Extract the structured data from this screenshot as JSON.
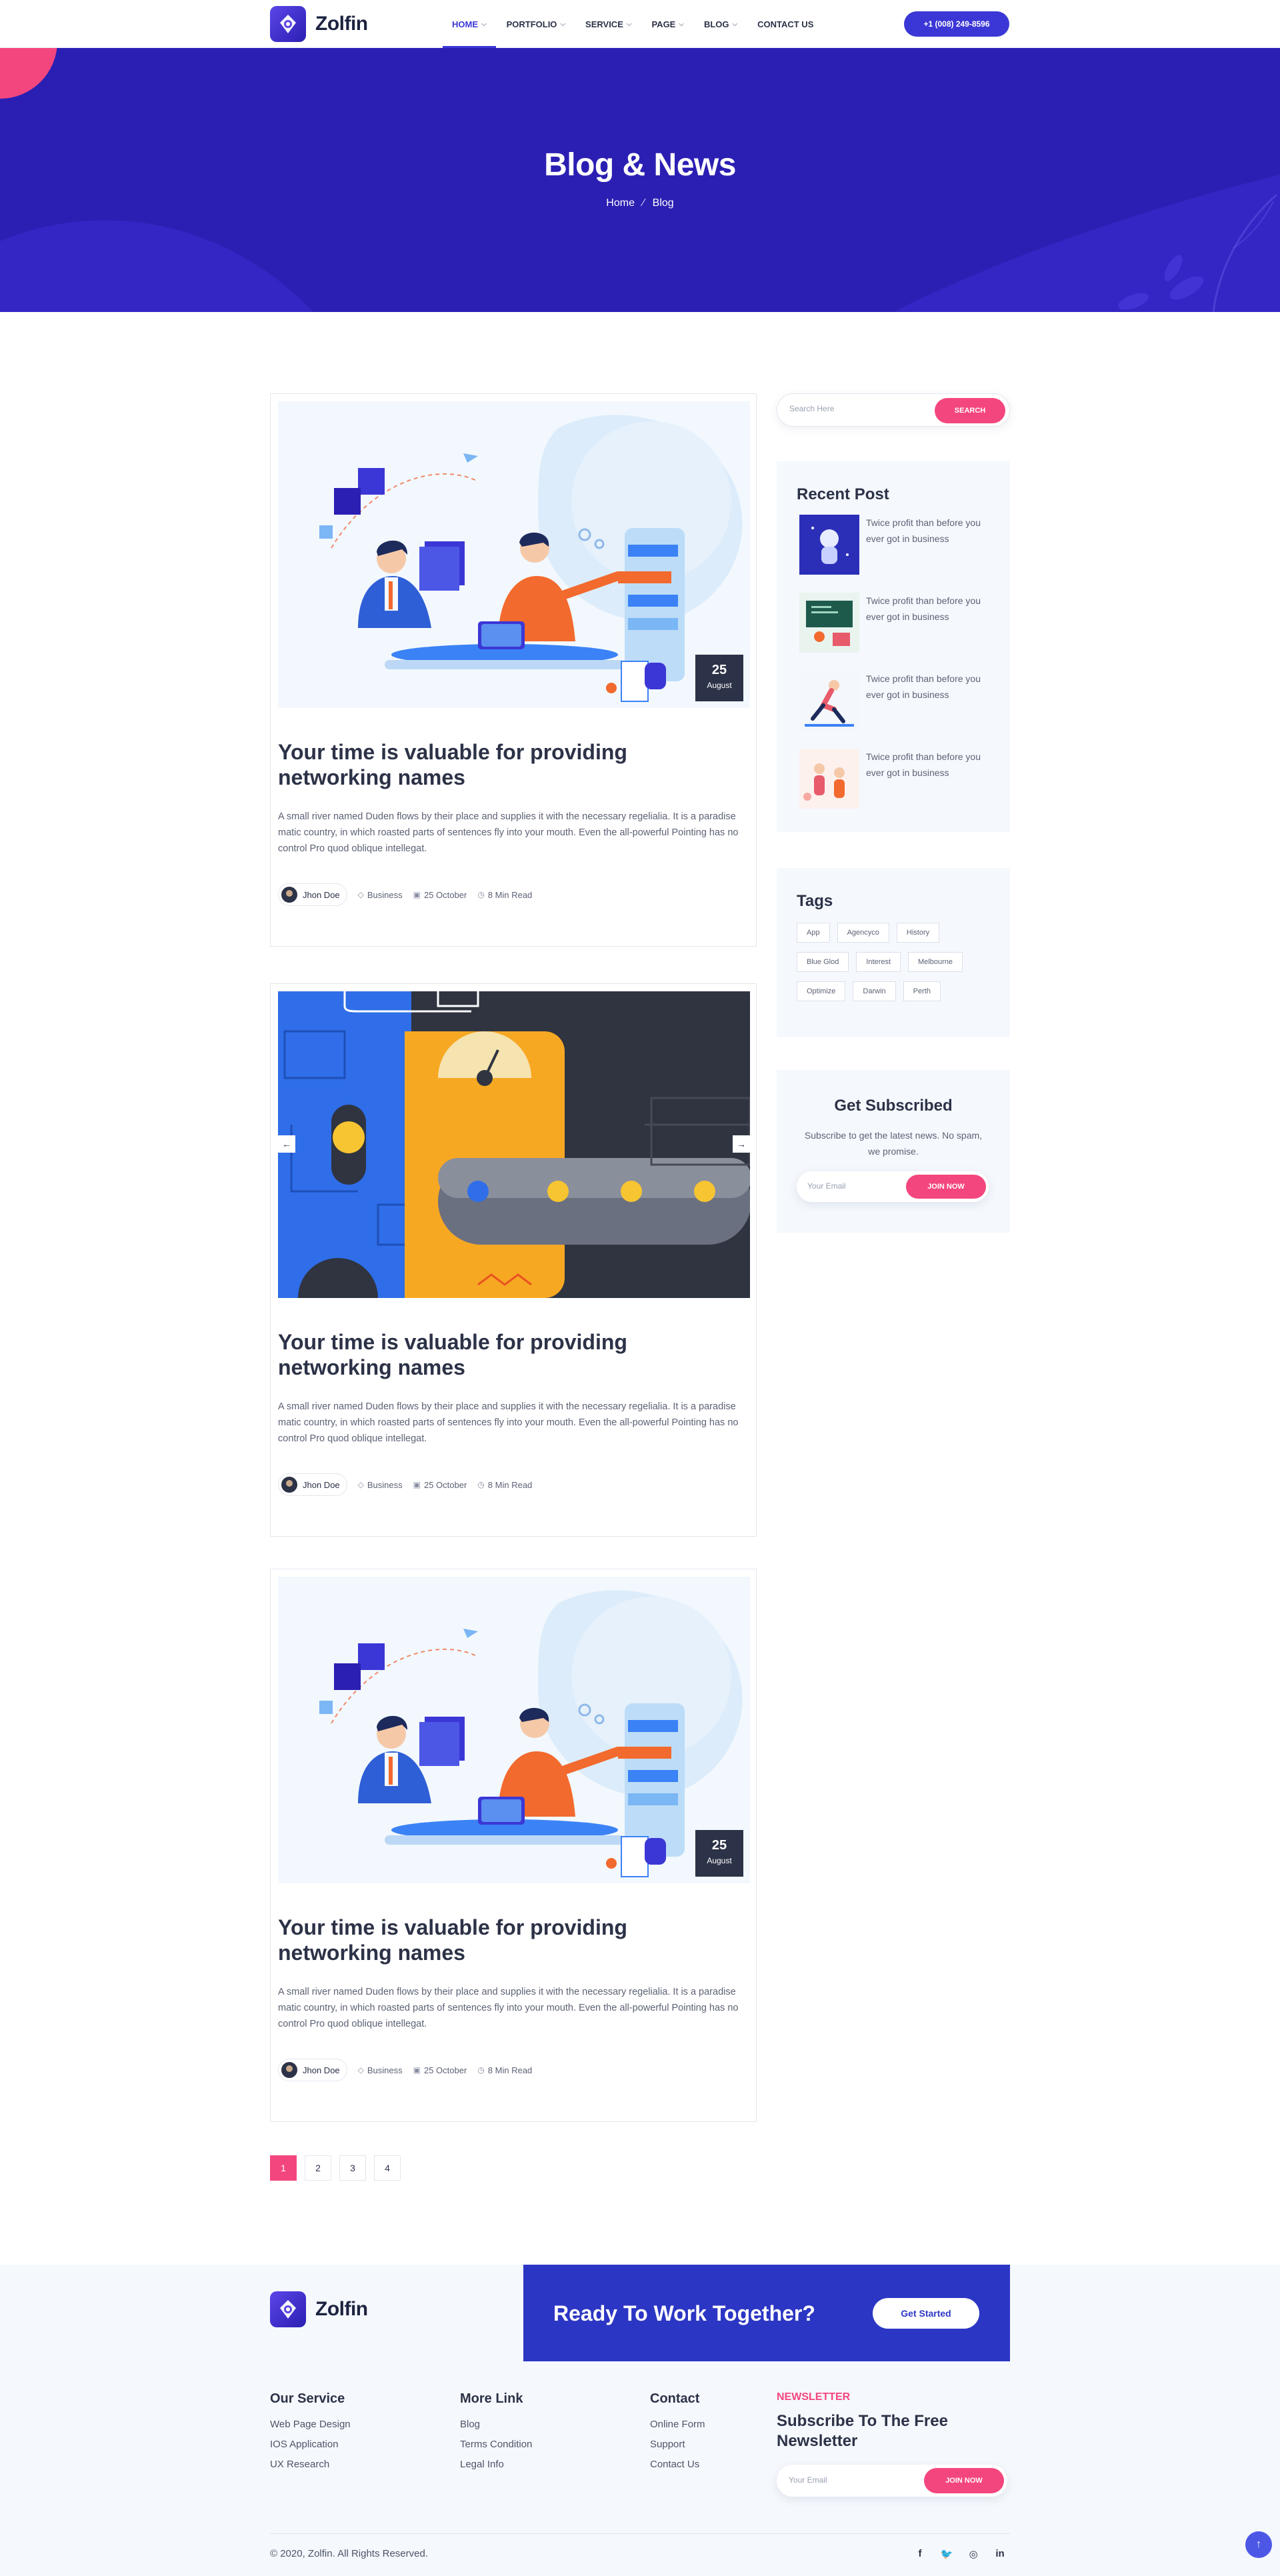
{
  "brand": {
    "name": "Zolfin"
  },
  "nav": {
    "items": [
      {
        "label": "HOME",
        "has_dropdown": true,
        "active": true
      },
      {
        "label": "PORTFOLIO",
        "has_dropdown": true
      },
      {
        "label": "SERVICE",
        "has_dropdown": true
      },
      {
        "label": "PAGE",
        "has_dropdown": true
      },
      {
        "label": "BLOG",
        "has_dropdown": true
      },
      {
        "label": "CONTACT US",
        "has_dropdown": false
      }
    ],
    "phone": "+1 (008) 249-8596"
  },
  "hero": {
    "title": "Blog & News",
    "breadcrumb": [
      "Home",
      "Blog"
    ]
  },
  "posts": [
    {
      "image": "team-collaboration-illustration",
      "date_day": "25",
      "date_month": "August",
      "title": "Your time is valuable for providing networking names",
      "excerpt": "A small river named Duden flows by their place and supplies it with the necessary regelialia. It is a paradise matic country, in which roasted parts of sentences fly into your mouth. Even the all-powerful Pointing has no control Pro quod oblique intellegat.",
      "author": "Jhon Doe",
      "category": "Business",
      "date": "25 October",
      "read_time": "8 Min Read"
    },
    {
      "image": "machine-slider-illustration",
      "title": "Your time is valuable for providing networking names",
      "excerpt": "A small river named Duden flows by their place and supplies it with the necessary regelialia. It is a paradise matic country, in which roasted parts of sentences fly into your mouth. Even the all-powerful Pointing has no control Pro quod oblique intellegat.",
      "author": "Jhon Doe",
      "category": "Business",
      "date": "25 October",
      "read_time": "8 Min Read"
    },
    {
      "image": "team-collaboration-illustration",
      "date_day": "25",
      "date_month": "August",
      "title": "Your time is valuable for providing networking names",
      "excerpt": "A small river named Duden flows by their place and supplies it with the necessary regelialia. It is a paradise matic country, in which roasted parts of sentences fly into your mouth. Even the all-powerful Pointing has no control Pro quod oblique intellegat.",
      "author": "Jhon Doe",
      "category": "Business",
      "date": "25 October",
      "read_time": "8 Min Read"
    }
  ],
  "pagination": {
    "pages": [
      "1",
      "2",
      "3",
      "4"
    ],
    "current": "1"
  },
  "sidebar": {
    "search": {
      "placeholder": "Search Here",
      "button": "SEARCH"
    },
    "recent": {
      "title": "Recent Post",
      "items": [
        {
          "text": "Twice profit than before you ever got in business",
          "thumb": "astronaut-thumb"
        },
        {
          "text": "Twice profit than before you ever got in business",
          "thumb": "classroom-thumb"
        },
        {
          "text": "Twice profit than before you ever got in business",
          "thumb": "runner-thumb"
        },
        {
          "text": "Twice profit than before you ever got in business",
          "thumb": "people-thumb"
        }
      ]
    },
    "tags": {
      "title": "Tags",
      "items": [
        "App",
        "Agencyco",
        "History",
        "Blue Glod",
        "Interest",
        "Melbourne",
        "Optimize",
        "Darwin",
        "Perth"
      ]
    },
    "subscribe": {
      "title": "Get Subscribed",
      "text": "Subscribe to get the latest news. No spam, we promise.",
      "placeholder": "Your Email",
      "button": "JOIN NOW"
    }
  },
  "footer": {
    "cta_title": "Ready To Work Together?",
    "cta_button": "Get Started",
    "columns": [
      {
        "title": "Our Service",
        "links": [
          "Web Page Design",
          "IOS Application",
          "UX Research"
        ]
      },
      {
        "title": "More Link",
        "links": [
          "Blog",
          "Terms Condition",
          "Legal Info"
        ]
      },
      {
        "title": "Contact",
        "links": [
          "Online Form",
          "Support",
          "Contact Us"
        ]
      }
    ],
    "newsletter": {
      "kicker": "NEWSLETTER",
      "title": "Subscribe To The Free Newsletter",
      "placeholder": "Your Email",
      "button": "JOIN NOW"
    },
    "copyright": "© 2020, Zolfin. All Rights Reserved.",
    "socials": [
      {
        "label": "f",
        "icon": "facebook-icon"
      },
      {
        "label": "🐦",
        "icon": "twitter-icon"
      },
      {
        "label": "◎",
        "icon": "instagram-icon"
      },
      {
        "label": "in",
        "icon": "linkedin-icon"
      }
    ]
  },
  "colors": {
    "primary": "#2b1fb3",
    "accent": "#f4467e",
    "dark": "#2c3247"
  }
}
